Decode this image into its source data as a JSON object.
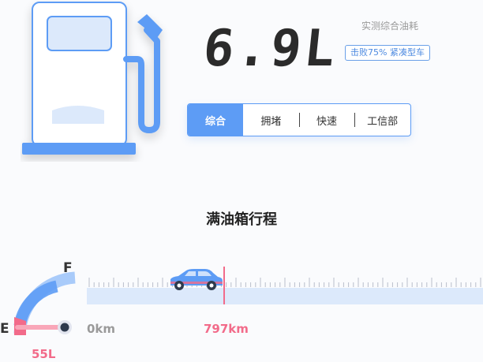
{
  "reading": {
    "value": "6.9L",
    "caption": "实测综合油耗",
    "badge": "击败75% 紧凑型车"
  },
  "mode_tabs": [
    {
      "label": "综合",
      "active": true
    },
    {
      "label": "拥堵",
      "active": false
    },
    {
      "label": "快速",
      "active": false
    },
    {
      "label": "工信部",
      "active": false
    }
  ],
  "range": {
    "title": "满油箱行程",
    "start_label": "0km",
    "end_label": "797km",
    "tank_full_label": "F",
    "tank_empty_label": "E",
    "tank_volume": "55L"
  },
  "icons": {
    "pump": "fuel-pump-icon",
    "car": "car-icon"
  },
  "colors": {
    "accent": "#5d9cf5",
    "accent_light": "#a9cbfa",
    "range_track": "#dce9fb",
    "marker": "#f26b8a",
    "text_dark": "#2b2b2b",
    "text_muted": "#999999"
  }
}
